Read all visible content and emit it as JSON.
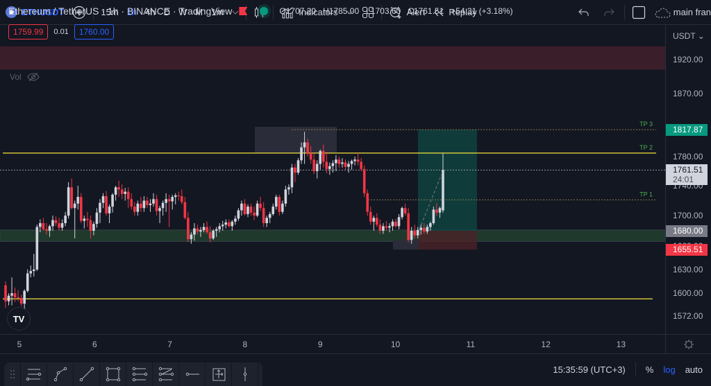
{
  "toolbar": {
    "symbol": "ETHUSDT",
    "add_symbol_icon": "plus-circle-icon",
    "timeframes": [
      {
        "label": "15m",
        "active": false
      },
      {
        "label": "1h",
        "active": true
      },
      {
        "label": "4h",
        "active": false
      },
      {
        "label": "D",
        "active": false
      },
      {
        "label": "W",
        "active": false
      },
      {
        "label": "M",
        "active": false
      },
      {
        "label": "1m",
        "active": false
      }
    ],
    "indicators_label": "Indicators",
    "alert_label": "Alert",
    "replay_label": "Replay",
    "layout_label": "main fran"
  },
  "legend": {
    "title": "Ethereum / TetherUS · 1h · BINANCE · TradingView",
    "open": "O1707.20",
    "high": "H1785.00",
    "low": "L1703.60",
    "close": "C1761.51",
    "change": "+54.31 (+3.18%)",
    "bid": "1759.99",
    "spread": "0.01",
    "ask": "1760.00",
    "vol_label": "Vol"
  },
  "price_axis": {
    "currency": "USDT",
    "ticks": [
      "1920.00",
      "1870.00",
      "1780.00",
      "1740.00",
      "1700.00",
      "1660.00",
      "1630.00",
      "1600.00",
      "1572.00"
    ],
    "labels": [
      {
        "name": "tp3-price-label",
        "price": 1817.87,
        "text": "1817.87",
        "bg": "#089981",
        "color": "#ffffff"
      },
      {
        "name": "last-price-label",
        "price": 1761.51,
        "text": "1761.51",
        "sub": "24:01",
        "bg": "#d1d4dc",
        "color": "#131722"
      },
      {
        "name": "entry-price-label",
        "price": 1680.0,
        "text": "1680.00",
        "bg": "#787b86",
        "color": "#ffffff"
      },
      {
        "name": "stop-price-label",
        "price": 1655.51,
        "text": "1655.51",
        "bg": "#f23645",
        "color": "#ffffff"
      }
    ]
  },
  "time_axis": {
    "labels": [
      "5",
      "6",
      "7",
      "8",
      "9",
      "10",
      "11",
      "12",
      "13"
    ]
  },
  "status": {
    "clock": "15:35:59 (UTC+3)",
    "percent": "%",
    "log": "log",
    "auto": "auto"
  },
  "annotations": {
    "tp1": "TP 1",
    "tp2": "TP 2",
    "tp3": "TP 3"
  },
  "colors": {
    "up": "#d1d4dc",
    "down": "#f23645",
    "accent": "#2962ff",
    "yellow_line": "#f7e23a",
    "support_zone": "#1f3a2c"
  },
  "chart_data": {
    "type": "candlestick",
    "title": "Ethereum / TetherUS · 1h · BINANCE",
    "scale": "log",
    "ylim": [
      1560,
      1940
    ],
    "x_ticks": [
      "5",
      "6",
      "7",
      "8",
      "9",
      "10",
      "11",
      "12",
      "13"
    ],
    "levels": {
      "resistance_yellow": 1785,
      "support_yellow": 1593,
      "tp1": 1721,
      "tp2": 1785,
      "tp3": 1817.87,
      "entry": 1680,
      "stop": 1655.51,
      "last_price": 1761.51,
      "support_zone": [
        1666,
        1681
      ],
      "resistance_zone": [
        1905,
        1940
      ]
    },
    "candles": [
      [
        1610,
        1615,
        1582,
        1590
      ],
      [
        1590,
        1600,
        1585,
        1597
      ],
      [
        1597,
        1620,
        1585,
        1600
      ],
      [
        1600,
        1607,
        1589,
        1595
      ],
      [
        1595,
        1604,
        1590,
        1594
      ],
      [
        1594,
        1598,
        1584,
        1587
      ],
      [
        1587,
        1605,
        1580,
        1603
      ],
      [
        1603,
        1630,
        1601,
        1625
      ],
      [
        1625,
        1635,
        1620,
        1628
      ],
      [
        1628,
        1650,
        1621,
        1630
      ],
      [
        1630,
        1688,
        1628,
        1685
      ],
      [
        1685,
        1695,
        1678,
        1690
      ],
      [
        1690,
        1697,
        1680,
        1682
      ],
      [
        1682,
        1690,
        1675,
        1680
      ],
      [
        1680,
        1688,
        1672,
        1686
      ],
      [
        1686,
        1700,
        1680,
        1694
      ],
      [
        1694,
        1699,
        1686,
        1690
      ],
      [
        1690,
        1697,
        1680,
        1684
      ],
      [
        1684,
        1695,
        1680,
        1690
      ],
      [
        1690,
        1705,
        1686,
        1700
      ],
      [
        1700,
        1745,
        1696,
        1738
      ],
      [
        1738,
        1750,
        1708,
        1710
      ],
      [
        1710,
        1720,
        1670,
        1716
      ],
      [
        1716,
        1740,
        1708,
        1725
      ],
      [
        1725,
        1730,
        1690,
        1693
      ],
      [
        1693,
        1700,
        1683,
        1696
      ],
      [
        1696,
        1705,
        1685,
        1694
      ],
      [
        1694,
        1700,
        1670,
        1680
      ],
      [
        1680,
        1692,
        1674,
        1689
      ],
      [
        1689,
        1710,
        1684,
        1704
      ],
      [
        1704,
        1722,
        1690,
        1717
      ],
      [
        1717,
        1730,
        1710,
        1726
      ],
      [
        1726,
        1733,
        1700,
        1703
      ],
      [
        1703,
        1715,
        1690,
        1712
      ],
      [
        1712,
        1730,
        1704,
        1728
      ],
      [
        1728,
        1740,
        1720,
        1738
      ],
      [
        1738,
        1747,
        1725,
        1735
      ],
      [
        1735,
        1742,
        1722,
        1729
      ],
      [
        1729,
        1737,
        1720,
        1732
      ],
      [
        1732,
        1738,
        1710,
        1722
      ],
      [
        1722,
        1730,
        1708,
        1712
      ],
      [
        1712,
        1718,
        1700,
        1705
      ],
      [
        1705,
        1720,
        1700,
        1716
      ],
      [
        1716,
        1725,
        1705,
        1710
      ],
      [
        1710,
        1726,
        1705,
        1720
      ],
      [
        1720,
        1725,
        1710,
        1714
      ],
      [
        1714,
        1722,
        1705,
        1716
      ],
      [
        1716,
        1730,
        1712,
        1722
      ],
      [
        1722,
        1728,
        1700,
        1706
      ],
      [
        1706,
        1713,
        1690,
        1710
      ],
      [
        1710,
        1720,
        1700,
        1717
      ],
      [
        1717,
        1730,
        1705,
        1722
      ],
      [
        1722,
        1728,
        1685,
        1719
      ],
      [
        1719,
        1728,
        1708,
        1725
      ],
      [
        1725,
        1730,
        1715,
        1727
      ],
      [
        1727,
        1732,
        1720,
        1726
      ],
      [
        1726,
        1735,
        1715,
        1718
      ],
      [
        1718,
        1725,
        1695,
        1697
      ],
      [
        1697,
        1705,
        1665,
        1669
      ],
      [
        1669,
        1678,
        1663,
        1675
      ],
      [
        1675,
        1690,
        1667,
        1683
      ],
      [
        1683,
        1688,
        1675,
        1679
      ],
      [
        1679,
        1685,
        1672,
        1681
      ],
      [
        1681,
        1690,
        1678,
        1685
      ],
      [
        1685,
        1692,
        1676,
        1678
      ],
      [
        1678,
        1686,
        1665,
        1670
      ],
      [
        1670,
        1682,
        1668,
        1680
      ],
      [
        1680,
        1685,
        1672,
        1682
      ],
      [
        1682,
        1690,
        1678,
        1686
      ],
      [
        1686,
        1693,
        1680,
        1688
      ],
      [
        1688,
        1695,
        1683,
        1691
      ],
      [
        1691,
        1695,
        1684,
        1686
      ],
      [
        1686,
        1694,
        1680,
        1692
      ],
      [
        1692,
        1700,
        1688,
        1696
      ],
      [
        1696,
        1710,
        1693,
        1707
      ],
      [
        1707,
        1720,
        1700,
        1716
      ],
      [
        1716,
        1722,
        1700,
        1702
      ],
      [
        1702,
        1715,
        1698,
        1712
      ],
      [
        1712,
        1716,
        1700,
        1704
      ],
      [
        1704,
        1712,
        1694,
        1700
      ],
      [
        1700,
        1720,
        1698,
        1716
      ],
      [
        1716,
        1725,
        1706,
        1710
      ],
      [
        1710,
        1718,
        1685,
        1690
      ],
      [
        1690,
        1700,
        1685,
        1697
      ],
      [
        1697,
        1705,
        1690,
        1702
      ],
      [
        1702,
        1716,
        1700,
        1712
      ],
      [
        1712,
        1728,
        1708,
        1725
      ],
      [
        1725,
        1728,
        1700,
        1705
      ],
      [
        1705,
        1720,
        1702,
        1716
      ],
      [
        1716,
        1740,
        1712,
        1735
      ],
      [
        1735,
        1742,
        1728,
        1738
      ],
      [
        1738,
        1770,
        1730,
        1765
      ],
      [
        1765,
        1770,
        1745,
        1758
      ],
      [
        1758,
        1778,
        1755,
        1775
      ],
      [
        1775,
        1800,
        1770,
        1793
      ],
      [
        1793,
        1815,
        1770,
        1800
      ],
      [
        1800,
        1805,
        1780,
        1785
      ],
      [
        1785,
        1795,
        1770,
        1776
      ],
      [
        1776,
        1785,
        1756,
        1760
      ],
      [
        1760,
        1775,
        1750,
        1770
      ],
      [
        1770,
        1790,
        1762,
        1788
      ],
      [
        1788,
        1797,
        1765,
        1773
      ],
      [
        1773,
        1785,
        1757,
        1763
      ],
      [
        1763,
        1772,
        1755,
        1767
      ],
      [
        1767,
        1775,
        1758,
        1771
      ],
      [
        1771,
        1782,
        1760,
        1776
      ],
      [
        1776,
        1780,
        1765,
        1770
      ],
      [
        1770,
        1778,
        1765,
        1772
      ],
      [
        1772,
        1776,
        1762,
        1766
      ],
      [
        1766,
        1774,
        1758,
        1770
      ],
      [
        1770,
        1776,
        1762,
        1774
      ],
      [
        1774,
        1780,
        1768,
        1776
      ],
      [
        1776,
        1785,
        1768,
        1773
      ],
      [
        1773,
        1778,
        1760,
        1763
      ],
      [
        1763,
        1768,
        1725,
        1730
      ],
      [
        1730,
        1735,
        1700,
        1705
      ],
      [
        1705,
        1712,
        1688,
        1692
      ],
      [
        1692,
        1700,
        1680,
        1697
      ],
      [
        1697,
        1703,
        1685,
        1688
      ],
      [
        1688,
        1695,
        1676,
        1680
      ],
      [
        1680,
        1690,
        1676,
        1686
      ],
      [
        1686,
        1693,
        1680,
        1684
      ],
      [
        1684,
        1690,
        1678,
        1686
      ],
      [
        1686,
        1695,
        1680,
        1692
      ],
      [
        1692,
        1696,
        1684,
        1686
      ],
      [
        1686,
        1702,
        1682,
        1698
      ],
      [
        1698,
        1712,
        1695,
        1710
      ],
      [
        1710,
        1716,
        1700,
        1703
      ],
      [
        1703,
        1710,
        1665,
        1668
      ],
      [
        1668,
        1685,
        1663,
        1680
      ],
      [
        1680,
        1688,
        1670,
        1674
      ],
      [
        1674,
        1685,
        1670,
        1681
      ],
      [
        1681,
        1688,
        1675,
        1684
      ],
      [
        1684,
        1690,
        1676,
        1679
      ],
      [
        1679,
        1688,
        1676,
        1685
      ],
      [
        1685,
        1692,
        1680,
        1690
      ],
      [
        1690,
        1712,
        1688,
        1708
      ],
      [
        1708,
        1717,
        1700,
        1704
      ],
      [
        1704,
        1712,
        1697,
        1710
      ],
      [
        1707,
        1785,
        1704,
        1761.51
      ]
    ]
  }
}
